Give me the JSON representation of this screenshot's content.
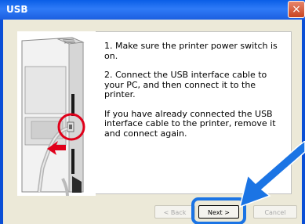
{
  "window": {
    "title": "USB",
    "close_glyph": "×"
  },
  "instructions": {
    "step1": "1. Make sure the printer power switch is on.",
    "step2": "2. Connect the USB interface cable to your PC, and then connect it to the printer.",
    "step3": "If you have already connected the USB interface cable to the printer, remove it and connect again."
  },
  "buttons": {
    "back_label": "< Back",
    "next_label": "Next >",
    "cancel_label": "Cancel"
  },
  "colors": {
    "titlebar": "#0a5ee6",
    "highlight": "#1b74e4",
    "callout_circle": "#e0001a",
    "arrow_red": "#e0001a",
    "arrow_blue": "#1b74e4"
  },
  "icons": {
    "close": "close-icon",
    "illustration": "printer-usb-port-illustration",
    "callout": "red-circle-callout",
    "pointer": "blue-arrow-icon"
  }
}
